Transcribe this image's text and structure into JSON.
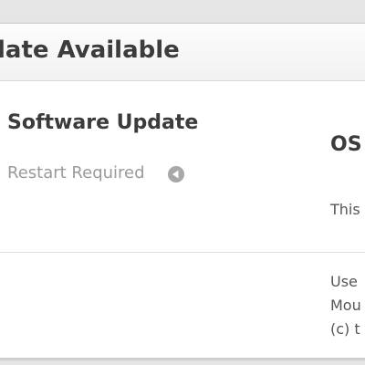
{
  "window": {
    "title": "late Available"
  },
  "update": {
    "name": "Software Update",
    "status": "Restart Required",
    "status_icon": "info-arrow-icon"
  },
  "details": {
    "heading": "OS",
    "description_start": "This"
  },
  "footer": {
    "lines": [
      "Use",
      "Mou",
      "(c) t"
    ]
  },
  "colors": {
    "header_text": "#3c3c3c",
    "secondary_text": "#9a9a9a",
    "icon_fill": "#a8a8a8"
  }
}
